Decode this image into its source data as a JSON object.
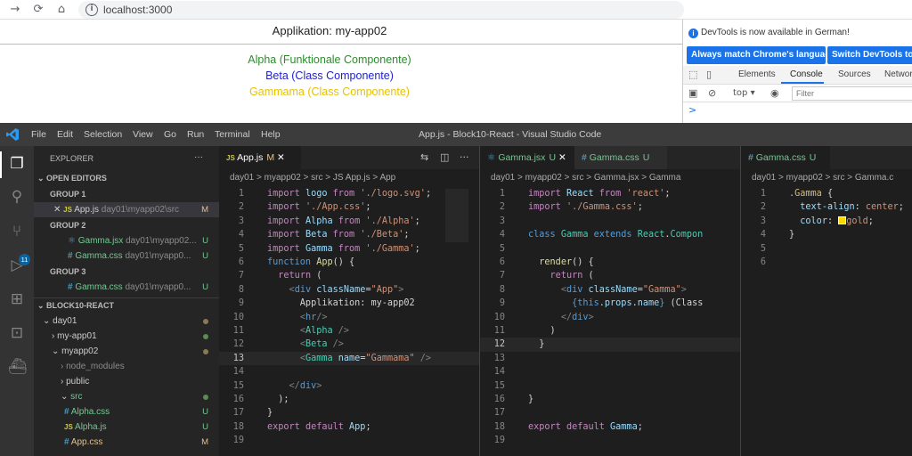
{
  "browser": {
    "url": "localhost:3000"
  },
  "page": {
    "title": "Applikation: my-app02",
    "alpha": "Alpha (Funktionale Componente)",
    "beta": "Beta (Class Componente)",
    "gamma": "Gammama (Class Componente)",
    "colors": {
      "alpha": "#2e8b2e",
      "beta": "#2222cc",
      "gamma": "#e6c200"
    }
  },
  "devtools": {
    "notice": "DevTools is now available in German!",
    "btn_match": "Always match Chrome's language",
    "btn_switch": "Switch DevTools to G",
    "tabs": [
      "Elements",
      "Console",
      "Sources",
      "Networ"
    ],
    "context": "top",
    "filter_placeholder": "Filter",
    "prompt": ">"
  },
  "vscode": {
    "window_title": "App.js - Block10-React - Visual Studio Code",
    "menu": [
      "File",
      "Edit",
      "Selection",
      "View",
      "Go",
      "Run",
      "Terminal",
      "Help"
    ],
    "badge": "11",
    "explorer": {
      "title": "EXPLORER",
      "open_editors": "OPEN EDITORS",
      "group1": "GROUP 1",
      "group2": "GROUP 2",
      "group3": "GROUP 3",
      "g1_file": "App.js",
      "g1_path": "day01\\myapp02\\src",
      "g1_status": "M",
      "g2_file1": "Gamma.jsx",
      "g2_path1": "day01\\myapp02...",
      "g2_file2": "Gamma.css",
      "g2_path2": "day01\\myapp0...",
      "g3_file": "Gamma.css",
      "g3_path": "day01\\myapp0...",
      "u": "U",
      "m": "M",
      "project": "BLOCK10-REACT",
      "tree": [
        "day01",
        "my-app01",
        "myapp02",
        "node_modules",
        "public",
        "src",
        "Alpha.css",
        "Alpha.js",
        "App.css"
      ]
    },
    "editor1": {
      "tab": "App.js",
      "tab_status": "M",
      "breadcrumb": "day01 > myapp02 > src > JS App.js > App",
      "current_line": "13"
    },
    "editor2": {
      "tab1": "Gamma.jsx",
      "tab2": "Gamma.css",
      "breadcrumb": "day01 > myapp02 > src > Gamma.jsx > Gamma",
      "current_line": "12"
    },
    "editor3": {
      "tab": "Gamma.css",
      "breadcrumb": "day01 > myapp02 > src > Gamma.c"
    }
  }
}
